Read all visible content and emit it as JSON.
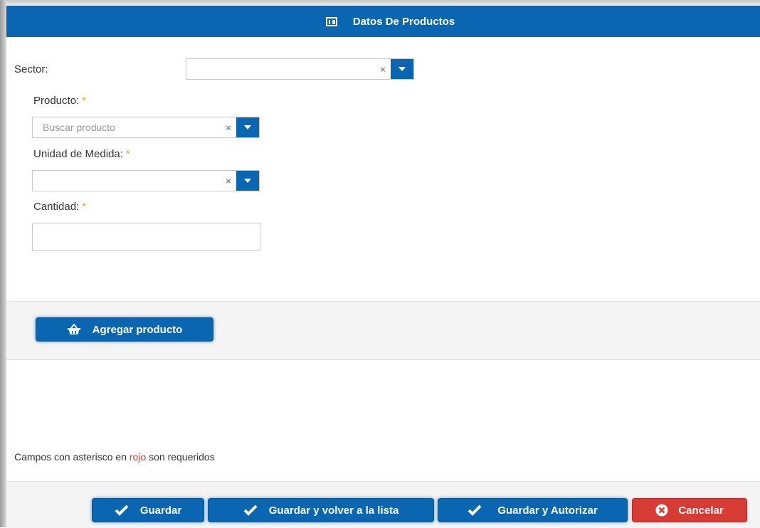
{
  "header": {
    "title": "Datos De Productos",
    "icon": "table-icon"
  },
  "form": {
    "sector": {
      "label": "Sector:",
      "placeholder": "",
      "clear": "×"
    },
    "producto": {
      "label": "Producto:",
      "required_mark": "*",
      "placeholder": "Buscar producto",
      "clear": "×"
    },
    "unidad": {
      "label": "Unidad de Medida:",
      "required_mark": "*",
      "placeholder": "",
      "clear": "×"
    },
    "cantidad": {
      "label": "Cantidad:",
      "required_mark": "*",
      "value": ""
    }
  },
  "add_button": {
    "label": "Agregar producto",
    "icon": "basket-icon"
  },
  "footnote": {
    "before": "Campos con asterisco en",
    "red_word": "rojo",
    "after": "son requeridos"
  },
  "actions": {
    "guardar": "Guardar",
    "guardar_lista": "Guardar y volver a la lista",
    "guardar_autorizar": "Guardar y Autorizar",
    "cancelar": "Cancelar"
  },
  "colors": {
    "primary": "#0a66b0",
    "danger": "#d63b34",
    "required": "#f0a030"
  }
}
